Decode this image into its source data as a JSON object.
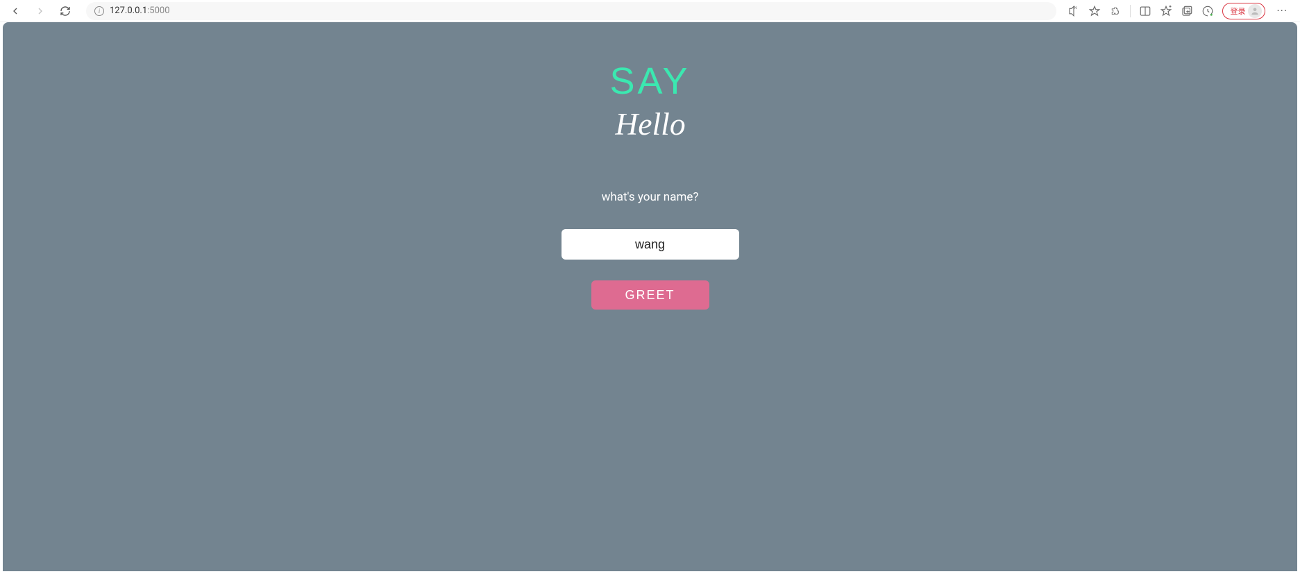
{
  "browser": {
    "url_host": "127.0.0.1",
    "url_port": ":5000",
    "login_label": "登录"
  },
  "page": {
    "heading_line1": "SAY",
    "heading_line2": "Hello",
    "prompt": "what's your name?",
    "name_input_value": "wang",
    "greet_button_label": "GREET"
  },
  "colors": {
    "page_bg": "#738490",
    "accent_teal": "#3be8b0",
    "button_pink": "#de6b91",
    "login_red": "#d9333f"
  }
}
